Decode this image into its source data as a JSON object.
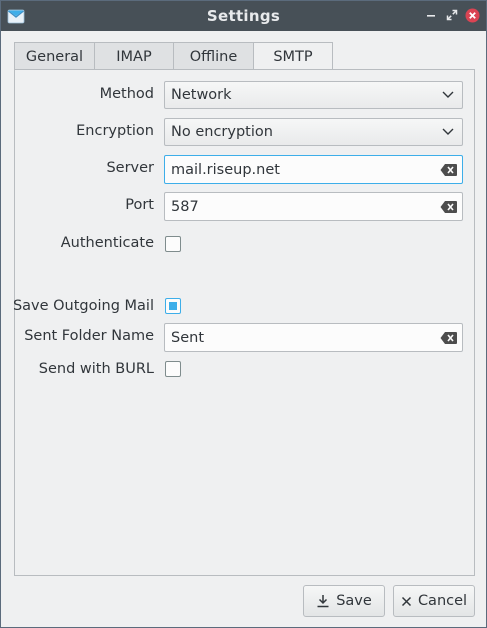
{
  "window": {
    "title": "Settings",
    "app_icon": "mail-envelope-icon",
    "controls": [
      "minimize-icon",
      "maximize-icon",
      "close-icon"
    ]
  },
  "tabs": [
    {
      "label": "General",
      "active": false
    },
    {
      "label": "IMAP",
      "active": false
    },
    {
      "label": "Offline",
      "active": false
    },
    {
      "label": "SMTP",
      "active": true
    }
  ],
  "smtp": {
    "method": {
      "label": "Method",
      "value": "Network"
    },
    "encryption": {
      "label": "Encryption",
      "value": "No encryption"
    },
    "server": {
      "label": "Server",
      "value": "mail.riseup.net"
    },
    "port": {
      "label": "Port",
      "value": "587"
    },
    "authenticate": {
      "label": "Authenticate",
      "checked": false
    },
    "save_outgoing": {
      "label": "Save Outgoing Mail",
      "checked": true
    },
    "sent_folder": {
      "label": "Sent Folder Name",
      "value": "Sent"
    },
    "send_burl": {
      "label": "Send with BURL",
      "checked": false
    }
  },
  "buttons": {
    "save": "Save",
    "cancel": "Cancel"
  },
  "colors": {
    "accent": "#3daee9",
    "titlebar": "#475057",
    "close": "#da4453"
  }
}
